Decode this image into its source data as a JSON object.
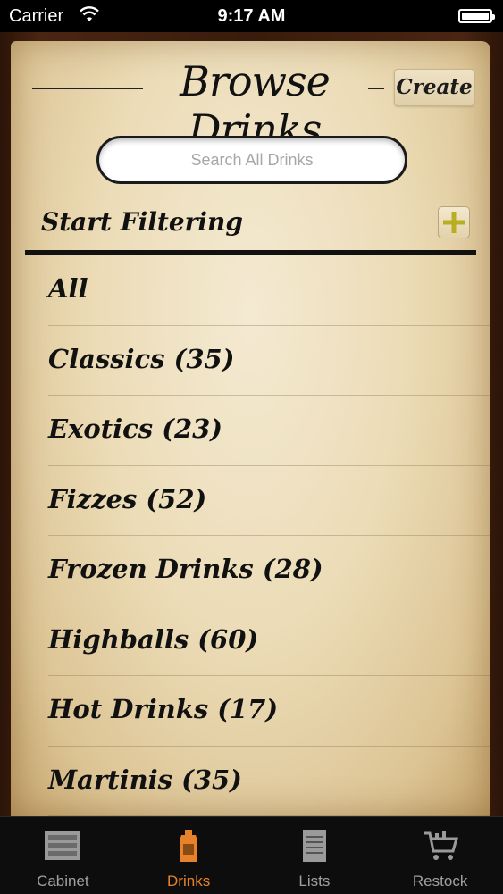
{
  "status_bar": {
    "carrier": "Carrier",
    "time": "9:17 AM"
  },
  "header": {
    "title": "Browse Drinks",
    "create_label": "Create"
  },
  "search": {
    "placeholder": "Search All Drinks"
  },
  "filter": {
    "label": "Start Filtering"
  },
  "categories": [
    {
      "label": "All"
    },
    {
      "label": "Classics (35)"
    },
    {
      "label": "Exotics (23)"
    },
    {
      "label": "Fizzes (52)"
    },
    {
      "label": "Frozen Drinks (28)"
    },
    {
      "label": "Highballs (60)"
    },
    {
      "label": "Hot Drinks (17)"
    },
    {
      "label": "Martinis (35)"
    }
  ],
  "tab_bar": {
    "tabs": [
      {
        "label": "Cabinet",
        "icon": "cabinet-icon",
        "active": false
      },
      {
        "label": "Drinks",
        "icon": "bottle-icon",
        "active": true
      },
      {
        "label": "Lists",
        "icon": "notepad-icon",
        "active": false
      },
      {
        "label": "Restock",
        "icon": "cart-icon",
        "active": false
      }
    ],
    "active_color": "#e8822a",
    "inactive_color": "#a0a0a0"
  },
  "colors": {
    "paper": "#ecdcb7",
    "wood": "#3a1c0c",
    "add_icon": "#b9ad22"
  }
}
